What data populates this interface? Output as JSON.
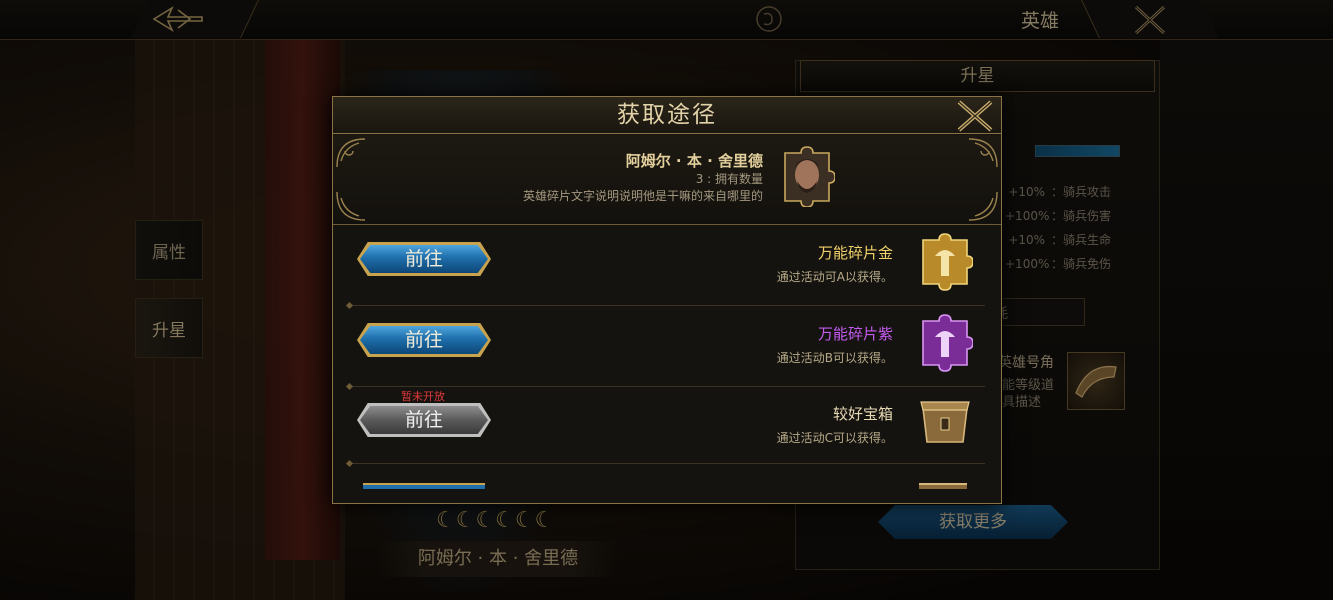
{
  "topbar": {
    "title": "英雄"
  },
  "side_tabs": [
    {
      "label": "属性"
    },
    {
      "label": "升星"
    }
  ],
  "right_panel": {
    "header": "升星",
    "stats": [
      {
        "value": "+10%",
        "label": "：骑兵攻击"
      },
      {
        "value": "+100%",
        "label": "：骑兵伤害"
      },
      {
        "value": "+10%",
        "label": "：骑兵生命"
      },
      {
        "value": "+100%",
        "label": "：骑兵免伤"
      }
    ],
    "cost_label_fragment": "耗",
    "horn_name": "英雄号角",
    "horn_desc_1": "能等级道",
    "horn_desc_2": "具描述",
    "more_button": "获取更多"
  },
  "hero_bottom": {
    "moons": "☾☾☾☾☾☾",
    "name": "阿姆尔 · 本 · 舍里德"
  },
  "modal": {
    "title": "获取途径",
    "hero": {
      "name": "阿姆尔 · 本 · 舍里德",
      "count_text": "3 : 拥有数量",
      "description": "英雄碎片文字说明说明他是干嘛的来自哪里的"
    },
    "sources": [
      {
        "button_label": "前往",
        "enabled": true,
        "locked_text": "",
        "item_name": "万能碎片金",
        "item_desc": "通过活动可A以获得。",
        "name_color": "#f2d36b",
        "icon": "gold-puzzle-piece-icon"
      },
      {
        "button_label": "前往",
        "enabled": true,
        "locked_text": "",
        "item_name": "万能碎片紫",
        "item_desc": "通过活动B可以获得。",
        "name_color": "#c55bf0",
        "icon": "purple-puzzle-piece-icon"
      },
      {
        "button_label": "前往",
        "enabled": false,
        "locked_text": "暂未开放",
        "item_name": "较好宝箱",
        "item_desc": "通过活动C可以获得。",
        "name_color": "#e8d9b5",
        "icon": "treasure-chest-icon"
      }
    ]
  }
}
